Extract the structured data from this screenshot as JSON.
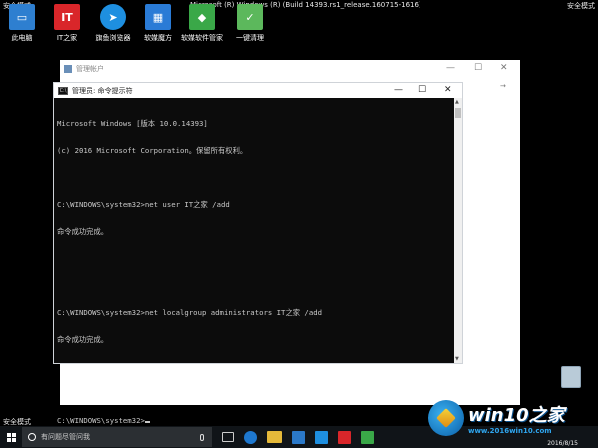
{
  "safe_mode": {
    "top_left": "安全模式",
    "top_right": "安全模式",
    "bottom_left": "安全模式"
  },
  "os_build": "Microsoft (R) Windows (R) (Build 14393.rs1_release.160715-1616)",
  "desktop_icons": [
    {
      "label": "此电脑",
      "icon": "computer-icon",
      "color": "#2e7fd0"
    },
    {
      "label": "IT之家",
      "icon": "ithome-icon",
      "color": "#d9262a"
    },
    {
      "label": "旗鱼浏览器",
      "icon": "browser-icon",
      "color": "#1e8fe0"
    },
    {
      "label": "软媒魔方",
      "icon": "cube-icon",
      "color": "#2a7bd6"
    },
    {
      "label": "软媒软件管家",
      "icon": "software-manager-icon",
      "color": "#3aa848"
    },
    {
      "label": "一键清理",
      "icon": "cleaner-icon",
      "color": "#5cb85c"
    }
  ],
  "background_window": {
    "title": "管理帐户"
  },
  "console": {
    "title": "管理员: 命令提示符",
    "lines": [
      "Microsoft Windows [版本 10.0.14393]",
      "(c) 2016 Microsoft Corporation。保留所有权利。",
      "",
      "C:\\WINDOWS\\system32>net user IT之家 /add",
      "命令成功完成。",
      "",
      "",
      "C:\\WINDOWS\\system32>net localgroup administrators IT之家 /add",
      "命令成功完成。",
      "",
      "",
      "C:\\WINDOWS\\system32>"
    ]
  },
  "taskbar": {
    "search_placeholder": "有问题尽管问我",
    "clock_date": "2016/8/15"
  },
  "watermark": {
    "title": "win10之家",
    "url": "www.2016win10.com"
  }
}
